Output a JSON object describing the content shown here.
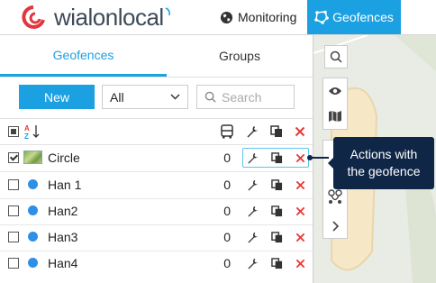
{
  "header": {
    "logo_text": "wialonlocal",
    "nav": [
      {
        "label": "Monitoring",
        "icon": "globe-icon"
      },
      {
        "label": "Geofences",
        "icon": "geofence-icon",
        "active": true
      }
    ]
  },
  "panel": {
    "tabs": [
      {
        "label": "Geofences",
        "active": true
      },
      {
        "label": "Groups",
        "active": false
      }
    ],
    "toolbar": {
      "new_label": "New",
      "filter_value": "All",
      "search_placeholder": "Search"
    },
    "rows": [
      {
        "name": "Circle",
        "count": "0",
        "checked": true,
        "type": "image"
      },
      {
        "name": "Han 1",
        "count": "0",
        "checked": false,
        "type": "dot"
      },
      {
        "name": "Han2",
        "count": "0",
        "checked": false,
        "type": "dot"
      },
      {
        "name": "Han3",
        "count": "0",
        "checked": false,
        "type": "dot"
      },
      {
        "name": "Han4",
        "count": "0",
        "checked": false,
        "type": "dot"
      }
    ]
  },
  "tooltip": {
    "line1": "Actions with",
    "line2": "the geofence"
  },
  "colors": {
    "accent": "#1ba0e2",
    "tooltip_bg": "#0f2647",
    "delete": "#e53935",
    "dot": "#2f8fe8"
  }
}
